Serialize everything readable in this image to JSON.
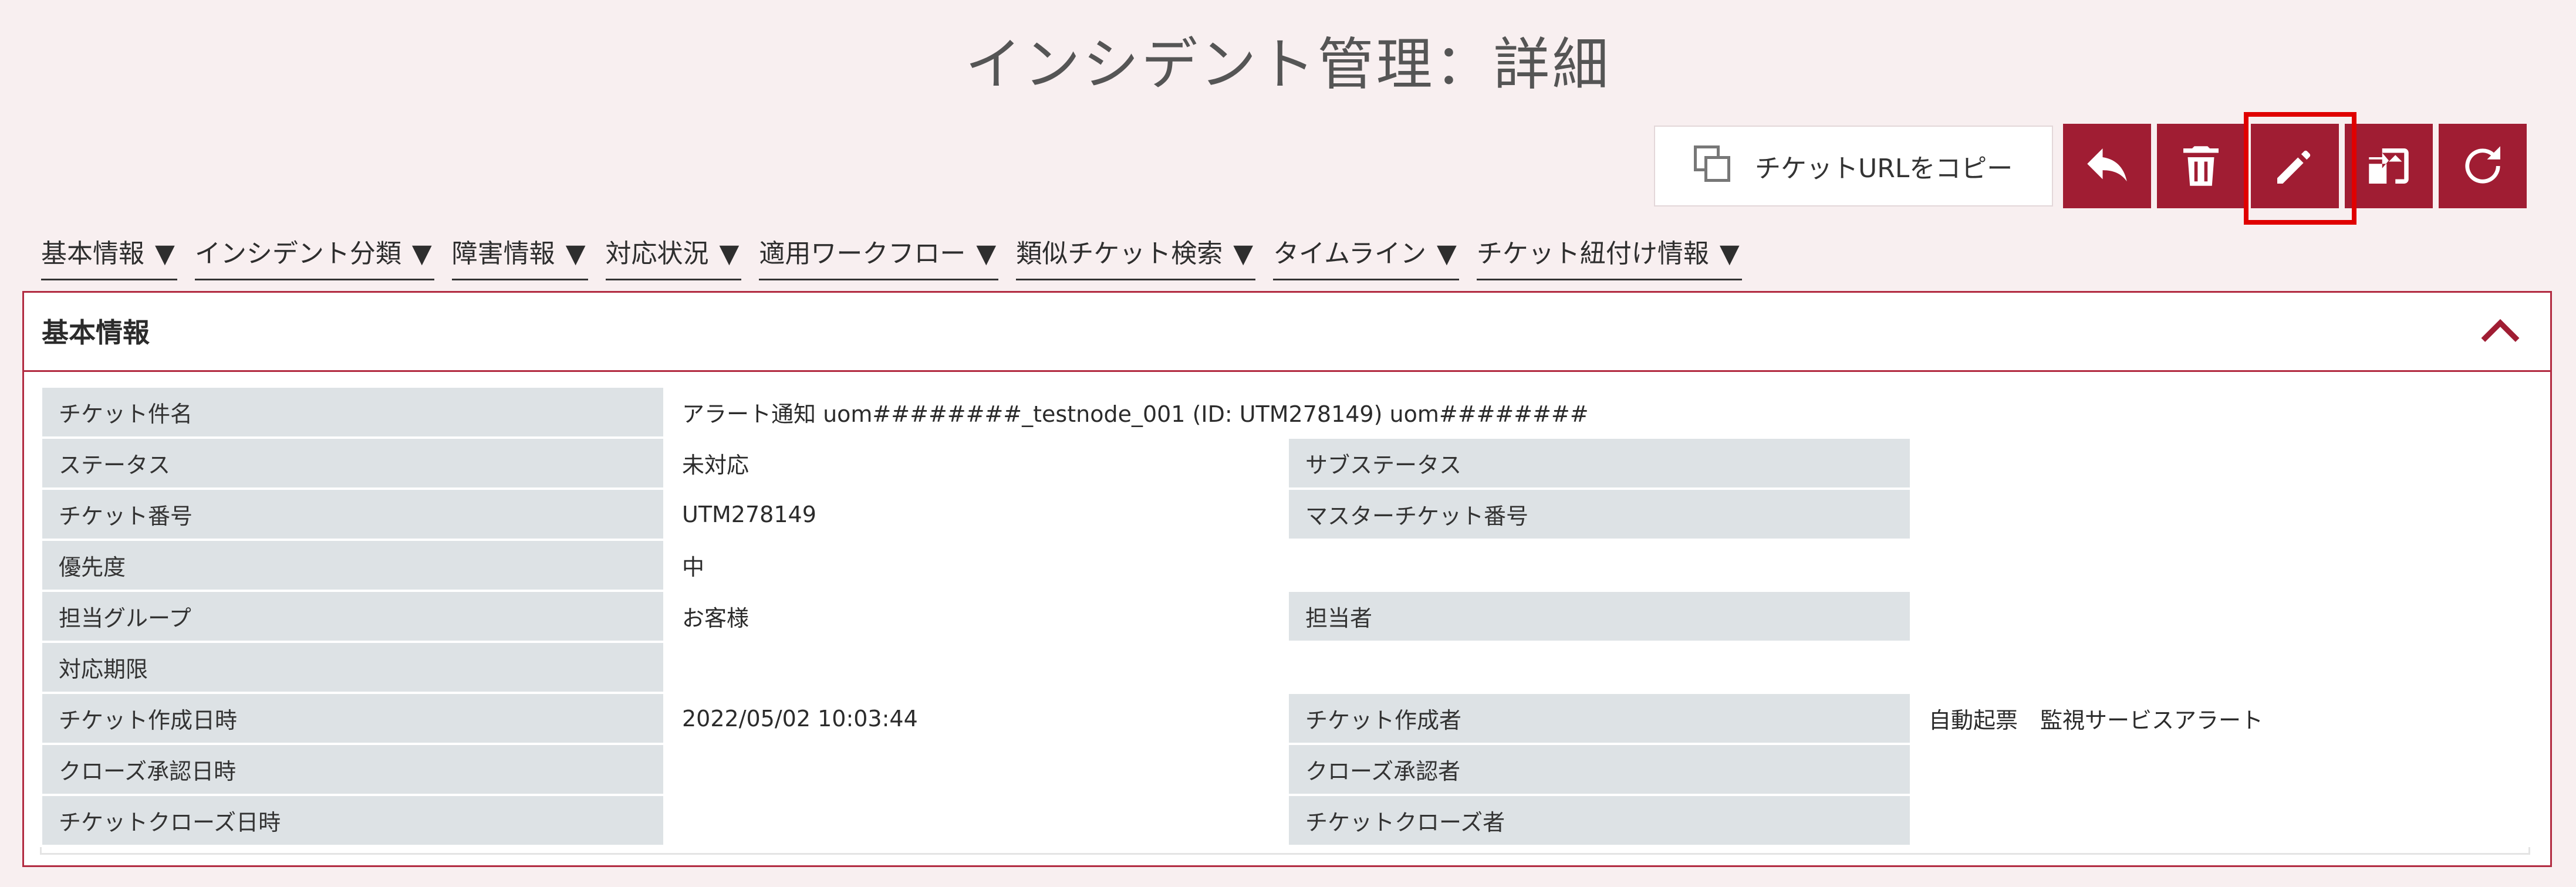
{
  "page": {
    "title": "インシデント管理：詳細"
  },
  "toolbar": {
    "copy_label": "チケットURLをコピー",
    "buttons": [
      "back-icon",
      "trash-icon",
      "pencil-icon",
      "swap-icon",
      "refresh-icon"
    ],
    "accent": "#a01d33",
    "highlight_color": "#e00000"
  },
  "nav": [
    "基本情報",
    "インシデント分類",
    "障害情報",
    "対応状況",
    "適用ワークフロー",
    "類似チケット検索",
    "タイムライン",
    "チケット紐付け情報"
  ],
  "nav_marker": "▼",
  "section": {
    "title": "基本情報",
    "rows": [
      {
        "l1": "チケット件名",
        "v1": "アラート通知 uom########_testnode_001 (ID: UTM278149) uom########"
      },
      {
        "l1": "ステータス",
        "v1": "未対応",
        "l2": "サブステータス",
        "v2": ""
      },
      {
        "l1": "チケット番号",
        "v1": "UTM278149",
        "l2": "マスターチケット番号",
        "v2": ""
      },
      {
        "l1": "優先度",
        "v1": "中"
      },
      {
        "l1": "担当グループ",
        "v1": "お客様",
        "l2": "担当者",
        "v2": ""
      },
      {
        "l1": "対応期限",
        "v1": ""
      },
      {
        "l1": "チケット作成日時",
        "v1": "2022/05/02 10:03:44",
        "l2": "チケット作成者",
        "v2": "自動起票　監視サービスアラート"
      },
      {
        "l1": "クローズ承認日時",
        "v1": "",
        "l2": "クローズ承認者",
        "v2": ""
      },
      {
        "l1": "チケットクローズ日時",
        "v1": "",
        "l2": "チケットクローズ者",
        "v2": ""
      }
    ]
  }
}
